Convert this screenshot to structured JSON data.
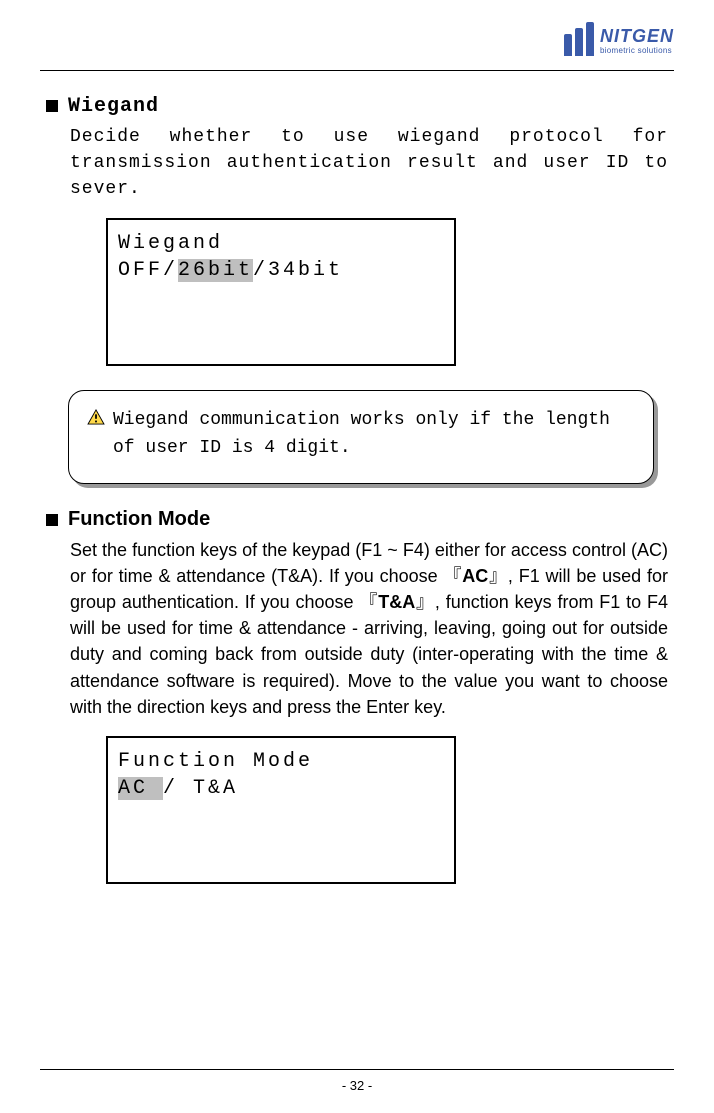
{
  "logo": {
    "brand": "NITGEN",
    "tagline": "biometric solutions"
  },
  "section1": {
    "title": "Wiegand",
    "body": "Decide whether to use wiegand protocol for transmission authentication result and user ID to sever.",
    "lcd": {
      "line1": "Wiegand",
      "opt_off": "OFF/",
      "opt_sel": "26bit",
      "opt_rest": "/34bit"
    },
    "warning": "Wiegand communication works only if the length of user ID is 4 digit."
  },
  "section2": {
    "title": "Function Mode",
    "body_pre": "Set the function keys of the keypad (F1 ~ F4) either for access control (AC) or for time & attendance (T&A). If you choose 『",
    "body_ac": "AC",
    "body_mid1": "』, F1 will be used for group authentication. If you choose 『",
    "body_ta": "T&A",
    "body_post": "』, function keys from F1 to F4 will be used for time & attendance - arriving, leaving, going out for outside duty and coming back from outside duty (inter-operating with the time & attendance software is required). Move to the value you want to choose with the direction keys and press the Enter key.",
    "lcd": {
      "line1": "Function Mode",
      "opt_sel": "AC ",
      "opt_rest": "/  T&A"
    }
  },
  "page_number": "- 32 -"
}
